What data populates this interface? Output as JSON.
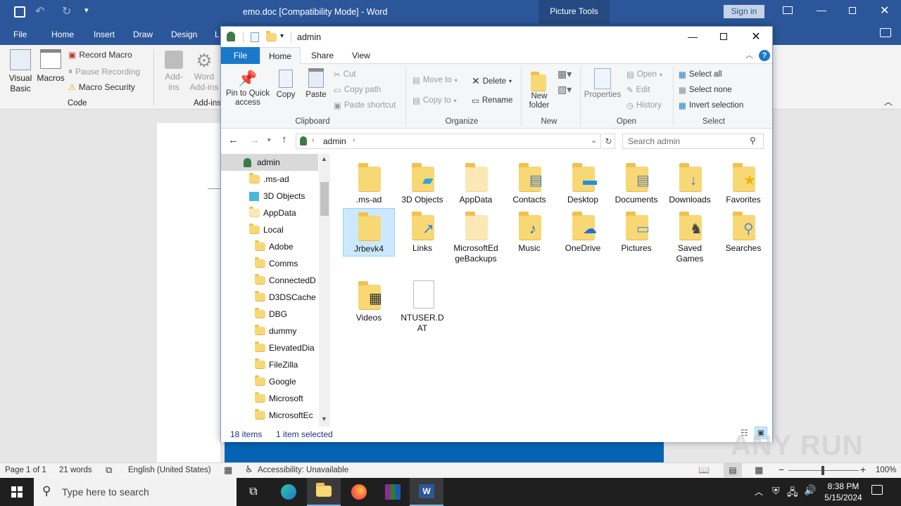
{
  "word": {
    "title": "emo.doc [Compatibility Mode]  -  Word",
    "context_tab": "Picture Tools",
    "sign_in": "Sign in",
    "tabs": [
      "File",
      "Home",
      "Insert",
      "Draw",
      "Design",
      "L"
    ],
    "ribbon": {
      "visual_basic": "Visual Basic",
      "macros": "Macros",
      "record_macro": "Record Macro",
      "pause_recording": "Pause Recording",
      "macro_security": "Macro Security",
      "code_group": "Code",
      "add_ins": "Add-ins",
      "word_add_ins": "Word Add-ins",
      "add_ins_group": "Add-ins"
    },
    "status": {
      "page": "Page 1 of 1",
      "words": "21 words",
      "language": "English (United States)",
      "accessibility": "Accessibility: Unavailable",
      "zoom": "100%"
    }
  },
  "explorer": {
    "title": "admin",
    "tabs": [
      "File",
      "Home",
      "Share",
      "View"
    ],
    "ribbon": {
      "pin": "Pin to Quick access",
      "copy": "Copy",
      "paste": "Paste",
      "cut": "Cut",
      "copy_path": "Copy path",
      "paste_shortcut": "Paste shortcut",
      "clipboard": "Clipboard",
      "move_to": "Move to",
      "copy_to": "Copy to",
      "delete": "Delete",
      "rename": "Rename",
      "organize": "Organize",
      "new_folder": "New folder",
      "new": "New",
      "properties": "Properties",
      "open": "Open",
      "edit": "Edit",
      "history": "History",
      "open_group": "Open",
      "select_all": "Select all",
      "select_none": "Select none",
      "invert_selection": "Invert selection",
      "select_group": "Select"
    },
    "address": "admin",
    "search_placeholder": "Search admin",
    "nav": [
      {
        "label": "admin",
        "level": 0
      },
      {
        "label": ".ms-ad",
        "level": 1
      },
      {
        "label": "3D Objects",
        "level": 1
      },
      {
        "label": "AppData",
        "level": 1
      },
      {
        "label": "Local",
        "level": 2
      },
      {
        "label": "Adobe",
        "level": 3
      },
      {
        "label": "Comms",
        "level": 3
      },
      {
        "label": "ConnectedD",
        "level": 3
      },
      {
        "label": "D3DSCache",
        "level": 3
      },
      {
        "label": "DBG",
        "level": 3
      },
      {
        "label": "dummy",
        "level": 3
      },
      {
        "label": "ElevatedDia",
        "level": 3
      },
      {
        "label": "FileZilla",
        "level": 3
      },
      {
        "label": "Google",
        "level": 3
      },
      {
        "label": "Microsoft",
        "level": 3
      },
      {
        "label": "MicrosoftEc",
        "level": 3
      }
    ],
    "items": [
      {
        "label": ".ms-ad",
        "icon": "folder"
      },
      {
        "label": "3D Objects",
        "icon": "3d-objects-folder"
      },
      {
        "label": "AppData",
        "icon": "hidden-folder"
      },
      {
        "label": "Contacts",
        "icon": "contacts-folder"
      },
      {
        "label": "Desktop",
        "icon": "desktop-folder"
      },
      {
        "label": "Documents",
        "icon": "documents-folder"
      },
      {
        "label": "Downloads",
        "icon": "downloads-folder"
      },
      {
        "label": "Favorites",
        "icon": "favorites-folder"
      },
      {
        "label": "Jrbevk4",
        "icon": "folder"
      },
      {
        "label": "Links",
        "icon": "links-folder"
      },
      {
        "label": "MicrosoftEdgeBackups",
        "icon": "hidden-folder"
      },
      {
        "label": "Music",
        "icon": "music-folder"
      },
      {
        "label": "OneDrive",
        "icon": "onedrive-folder"
      },
      {
        "label": "Pictures",
        "icon": "pictures-folder"
      },
      {
        "label": "Saved Games",
        "icon": "saved-games-folder"
      },
      {
        "label": "Searches",
        "icon": "searches-folder"
      },
      {
        "label": "Videos",
        "icon": "videos-folder"
      },
      {
        "label": "NTUSER.DAT",
        "icon": "file"
      }
    ],
    "status": {
      "count": "18 items",
      "selected": "1 item selected"
    }
  },
  "taskbar": {
    "search_placeholder": "Type here to search",
    "time": "8:38 PM",
    "date": "5/15/2024"
  },
  "watermark": "ANY RUN",
  "colors": {
    "word_blue": "#2b579a",
    "explorer_file_tab": "#1979ca",
    "selection": "#cce8ff",
    "taskbar": "#1f1f1f"
  }
}
